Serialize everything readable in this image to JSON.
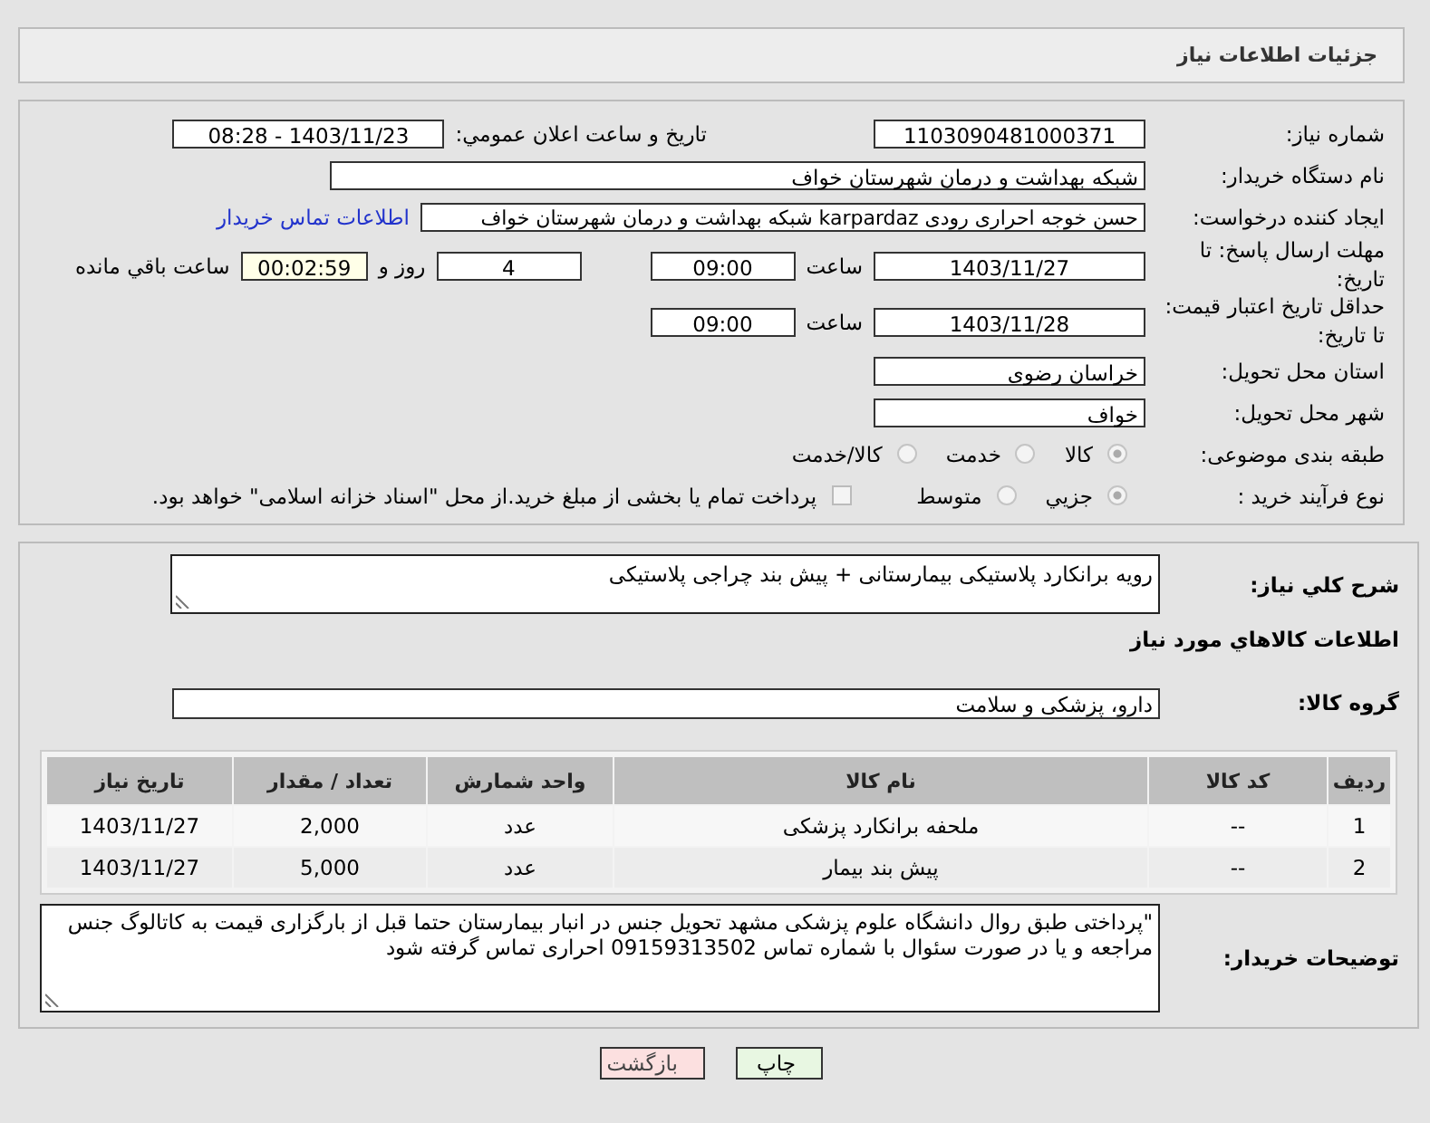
{
  "header": {
    "title": "جزئیات اطلاعات نیاز"
  },
  "need_number": {
    "label": "شماره نیاز:",
    "value": "1103090481000371"
  },
  "announce": {
    "label": "تاریخ و ساعت اعلان عمومي:",
    "value": "1403/11/23 - 08:28"
  },
  "buyer_org": {
    "label": "نام دستگاه خریدار:",
    "value": "شبکه بهداشت و درمان شهرستان خواف"
  },
  "requester": {
    "label": "ایجاد کننده درخواست:",
    "value": "حسن خوجه احراری رودی karpardaz شبکه بهداشت و درمان شهرستان خواف",
    "link": "اطلاعات تماس خریدار"
  },
  "deadline": {
    "label": "مهلت ارسال پاسخ: تا تاریخ:",
    "date": "1403/11/27",
    "time_label": "ساعت",
    "time": "09:00",
    "days": "4",
    "days_label": "روز و",
    "remaining": "00:02:59",
    "remaining_label": "ساعت باقي مانده"
  },
  "price_validity": {
    "label": "حداقل تاریخ اعتبار قیمت: تا تاریخ:",
    "date": "1403/11/28",
    "time_label": "ساعت",
    "time": "09:00"
  },
  "province": {
    "label": "استان محل تحویل:",
    "value": "خراسان رضوی"
  },
  "city": {
    "label": "شهر محل تحویل:",
    "value": "خواف"
  },
  "category": {
    "label": "طبقه بندی موضوعی:",
    "options": [
      {
        "label": "کالا",
        "selected": true
      },
      {
        "label": "خدمت",
        "selected": false
      },
      {
        "label": "کالا/خدمت",
        "selected": false
      }
    ]
  },
  "purchase_type": {
    "label": "نوع فرآیند خرید :",
    "options": [
      {
        "label": "جزیي",
        "selected": true
      },
      {
        "label": "متوسط",
        "selected": false
      }
    ],
    "treasury": {
      "checked": false,
      "label": "پرداخت تمام یا بخشی از مبلغ خرید.از محل \"اسناد خزانه اسلامی\" خواهد بود."
    }
  },
  "description": {
    "label": "شرح کلي نیاز:",
    "value": "رویه برانکارد پلاستیکی بیمارستانی + پیش بند چراجی پلاستیکی"
  },
  "goods": {
    "title": "اطلاعات کالاهاي مورد نیاز",
    "group_label": "گروه کالا:",
    "group": "دارو، پزشکی و سلامت",
    "columns": [
      "ردیف",
      "کد کالا",
      "نام کالا",
      "واحد شمارش",
      "تعداد / مقدار",
      "تاریخ نیاز"
    ],
    "rows": [
      [
        "1",
        "--",
        "ملحفه برانکارد پزشکی",
        "عدد",
        "2,000",
        "1403/11/27"
      ],
      [
        "2",
        "--",
        "پیش بند بیمار",
        "عدد",
        "5,000",
        "1403/11/27"
      ]
    ]
  },
  "buyer_notes": {
    "label": "توضیحات خریدار:",
    "value": "\"پرداختی طبق روال دانشگاه علوم پزشکی مشهد تحویل جنس در انبار بیمارستان  حتما قبل از بارگزاری قیمت به کاتالوگ جنس مراجعه و یا در صورت سئوال با  شماره تماس 09159313502 احراری تماس گرفته شود"
  },
  "buttons": [
    {
      "label": "چاپ",
      "kind": "print"
    },
    {
      "label": "بازگشت",
      "kind": "back"
    }
  ]
}
